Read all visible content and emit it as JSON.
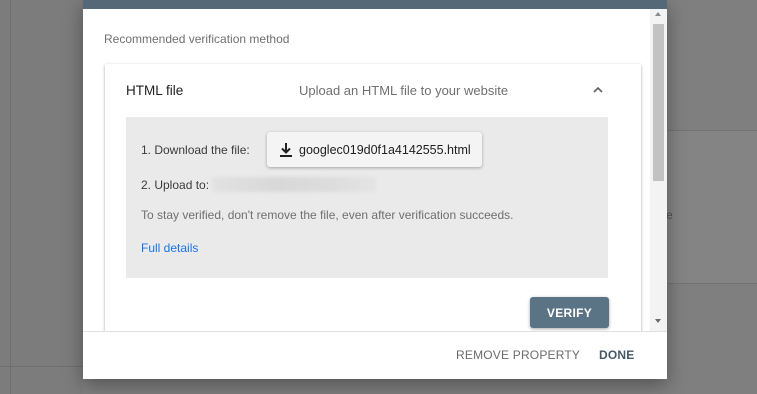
{
  "background": {
    "right_partial_text": "e"
  },
  "dialog": {
    "section_label": "Recommended verification method",
    "method": {
      "title": "HTML file",
      "description": "Upload an HTML file to your website",
      "expand_icon": "chevron-up-icon",
      "step1_label": "1. Download the file:",
      "download_icon": "download-icon",
      "download_filename": "googlec019d0f1a4142555.html",
      "step2_label": "2. Upload to:",
      "note": "To stay verified, don't remove the file, even after verification succeeds.",
      "full_details_link": "Full details",
      "verify_label": "VERIFY"
    },
    "footer": {
      "remove_label": "REMOVE PROPERTY",
      "done_label": "DONE"
    }
  },
  "colors": {
    "accent": "#5b7485",
    "header_bar": "#546878",
    "link": "#1a73e8",
    "overlay": "#7f7f7f"
  }
}
